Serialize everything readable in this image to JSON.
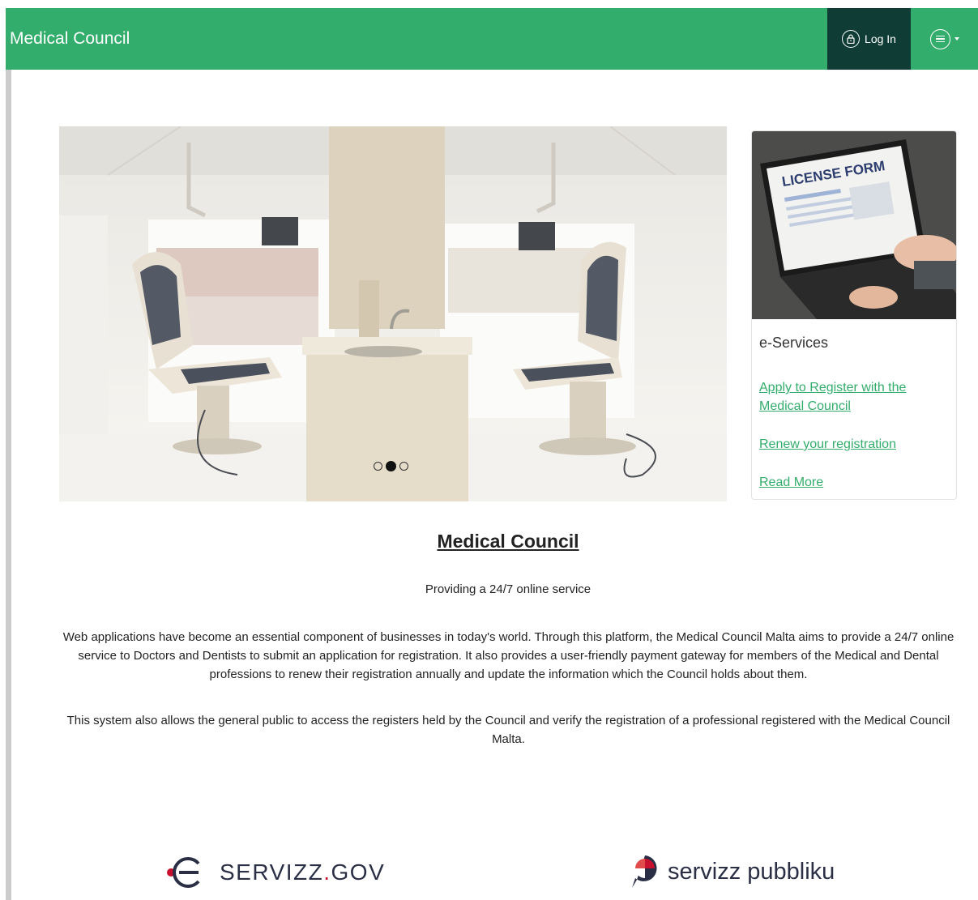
{
  "theme": {
    "primary": "#33ad6b",
    "login_bg": "#0f3d35",
    "link": "#33ad6b"
  },
  "navbar": {
    "brand": "Medical Council",
    "login_label": "Log In",
    "login_icon": "lock-icon",
    "menu_icon": "menu-circle-icon"
  },
  "carousel": {
    "slide_count": 3,
    "active_index": 1
  },
  "card": {
    "image_text": "LICENSE FORM",
    "title": "e-Services",
    "links": [
      {
        "label": "Apply to Register with the Medical Council"
      },
      {
        "label": "Renew your registration"
      },
      {
        "label": "Read More"
      }
    ]
  },
  "main": {
    "title": "Medical Council",
    "tagline": "Providing a 24/7 online service",
    "paragraphs": [
      "Web applications have become an essential component of businesses in today's world. Through this platform, the Medical Council Malta aims to provide a 24/7 online service to Doctors and Dentists to submit an application for registration. It also provides a user-friendly payment gateway for members of the Medical and Dental professions to renew their registration annually and update the information which the Council holds about them.",
      "This system also allows the general public to access the registers held by the Council and verify the registration of a professional registered with the Medical Council Malta."
    ]
  },
  "footer": {
    "logo_gov_a": "SERVIZZ",
    "logo_gov_sep": ".",
    "logo_gov_b": "GOV",
    "logo_pub": "servizz pubbliku"
  }
}
